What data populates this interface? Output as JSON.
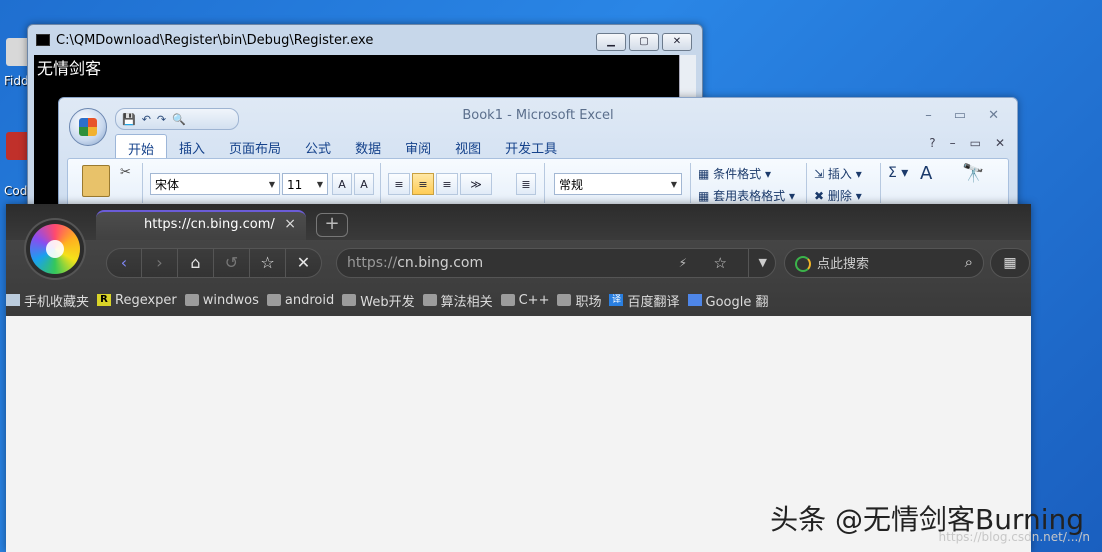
{
  "desktop": {
    "icons": [
      {
        "label": "Fidd"
      },
      {
        "label": "Cod"
      }
    ]
  },
  "console": {
    "title": "C:\\QMDownload\\Register\\bin\\Debug\\Register.exe",
    "output": "无情剑客"
  },
  "excel": {
    "title": "Book1 - Microsoft Excel",
    "tabs": [
      "开始",
      "插入",
      "页面布局",
      "公式",
      "数据",
      "审阅",
      "视图",
      "开发工具"
    ],
    "font_name": "宋体",
    "font_size": "11",
    "number_format": "常规",
    "conditional_format": "条件格式",
    "table_format": "套用表格格式",
    "insert": "插入",
    "delete": "删除"
  },
  "browser": {
    "tab_title": "https://cn.bing.com/",
    "address_scheme": "https://",
    "address_host": "cn.bing.com",
    "search_placeholder": "点此搜索",
    "bookmarks": [
      "手机收藏夹",
      "Regexper",
      "windwos",
      "android",
      "Web开发",
      "算法相关",
      "C++",
      "职场",
      "百度翻译",
      "Google 翻"
    ]
  },
  "watermark": {
    "main": "头条 @无情剑客Burning",
    "faint": "https://blog.csdn.net/.../n"
  }
}
